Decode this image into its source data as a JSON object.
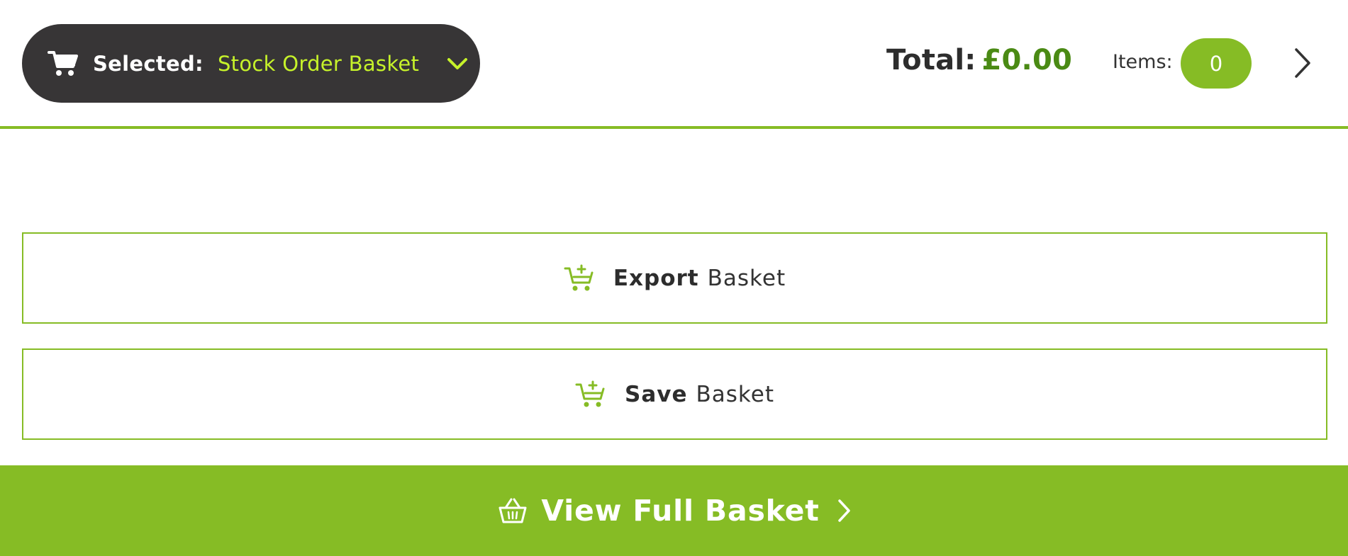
{
  "header": {
    "selector": {
      "label": "Selected:",
      "value": "Stock Order Basket",
      "icon": "shopping-cart-icon",
      "dropdown_icon": "chevron-down-icon"
    },
    "total": {
      "label": "Total:",
      "amount": "£0.00"
    },
    "items": {
      "label": "Items:",
      "count": "0"
    },
    "next_icon": "chevron-right-icon"
  },
  "actions": [
    {
      "strong": "Export",
      "light": "Basket",
      "icon": "cart-plus-icon"
    },
    {
      "strong": "Save",
      "light": "Basket",
      "icon": "cart-plus-icon"
    }
  ],
  "view_full": {
    "label": "View Full Basket",
    "icon": "basket-icon",
    "chevron": "chevron-right-icon"
  },
  "colors": {
    "accent_green": "#86bc25",
    "selector_bg": "#373536",
    "selector_value": "#c6f22a",
    "total_amount": "#4a8a14"
  }
}
